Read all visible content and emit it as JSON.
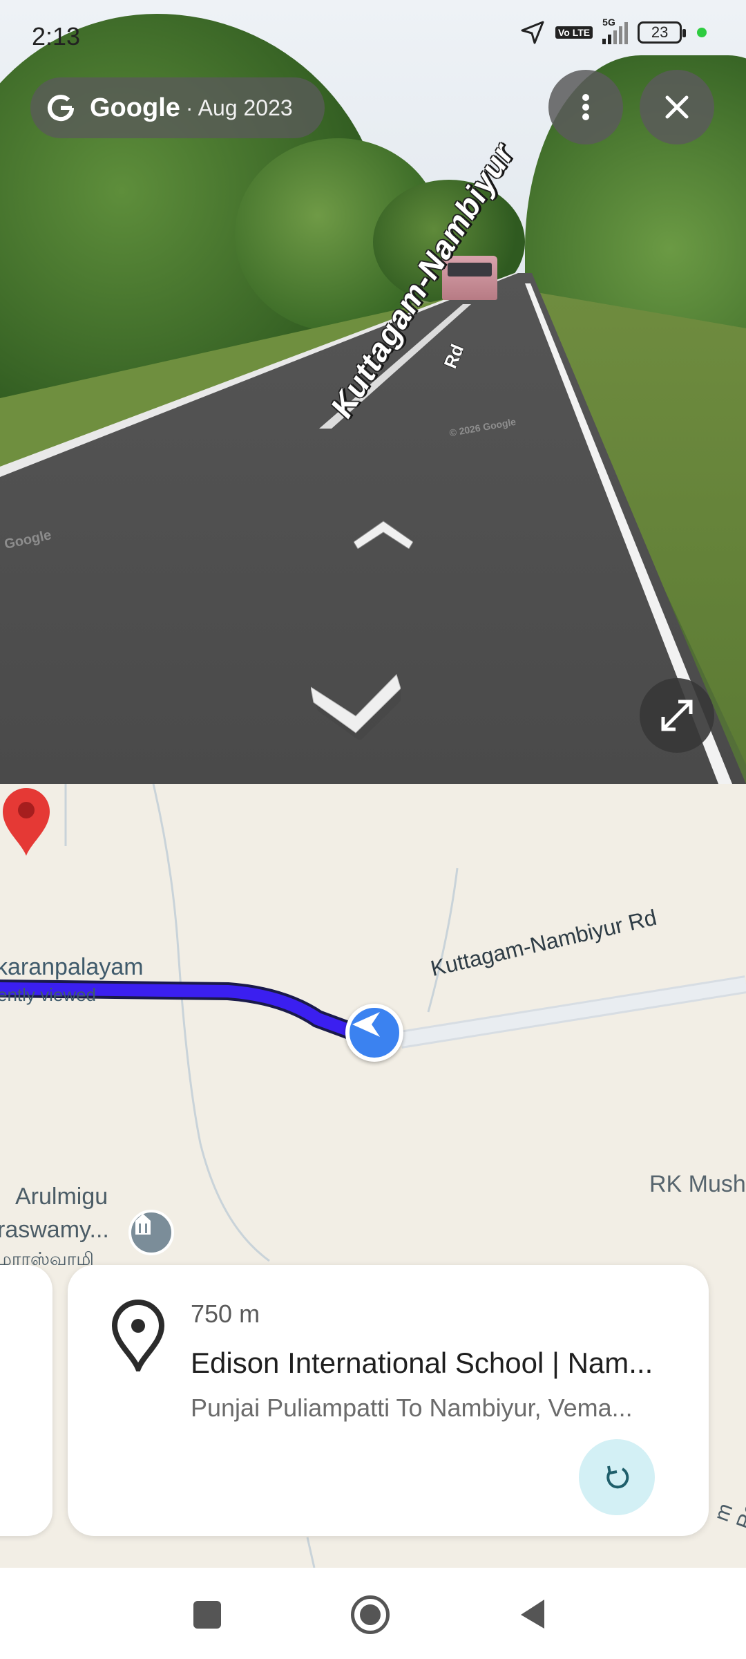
{
  "status_bar": {
    "time": "2:13",
    "network": "5G",
    "lte_badge": "Vo LTE",
    "battery": "23"
  },
  "street_view": {
    "attribution_brand": "Google",
    "attribution_date": "· Aug 2023",
    "road_label": "Kuttagam-Nambiyur",
    "road_label_sub": "Rd",
    "watermark_1": "Google",
    "watermark_2": "© 2026 Google",
    "icons": {
      "menu": "more-vertical-icon",
      "close": "close-icon",
      "expand": "expand-icon",
      "forward": "chevron-up-icon",
      "backward": "chevron-down-icon"
    }
  },
  "map": {
    "labels": {
      "place_left": "karanpalayam",
      "recently_viewed": "ently viewed",
      "road": "Kuttagam-Nambiyur Rd",
      "rk": "RK Mush",
      "temple_line1": "Arulmigu",
      "temple_line2": "raswamy...",
      "temple_tamil": "மாரஸ்வாமி",
      "road_bottom_right": "m Road"
    },
    "route_color": "#3b1ff0",
    "location_color": "#3b82f0",
    "pin_color": "#e53935"
  },
  "card": {
    "distance": "750 m",
    "title": "Edison International School | Nam...",
    "address": "Punjai Puliampatti To Nambiyur, Vema...",
    "refresh_icon": "refresh-icon"
  },
  "navbar": {
    "recents": "square-icon",
    "home": "home-circle-icon",
    "back": "back-triangle-icon"
  }
}
